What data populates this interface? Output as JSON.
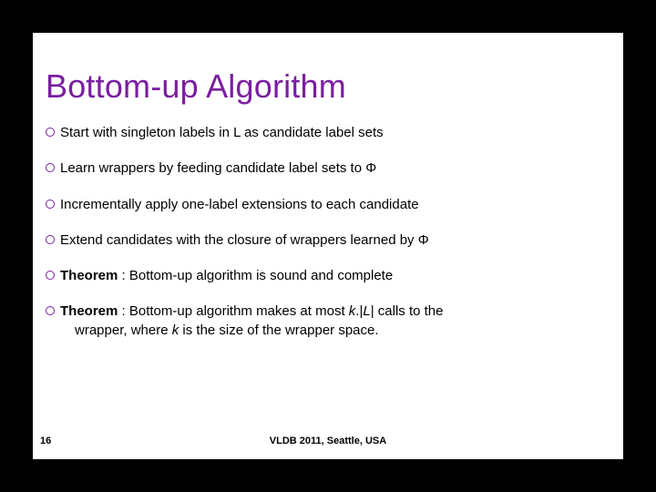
{
  "title": "Bottom-up Algorithm",
  "bullets": [
    {
      "html": "Start with singleton labels in L as candidate label sets"
    },
    {
      "html": "Learn wrappers by feeding candidate label sets to Φ"
    },
    {
      "html": "Incrementally apply one-label extensions to each candidate"
    },
    {
      "html": "Extend candidates with the closure of wrappers learned by Φ"
    },
    {
      "html": "<b>Theorem</b> : Bottom-up algorithm is sound and complete"
    },
    {
      "html": "<b>Theorem</b> : Bottom-up algorithm makes at most <i>k</i>.|<i>L</i>| calls to the<br><span class='indent'>wrapper, where <i>k</i> is the size of the wrapper space.</span>"
    }
  ],
  "page_number": "16",
  "footer": "VLDB 2011, Seattle, USA"
}
